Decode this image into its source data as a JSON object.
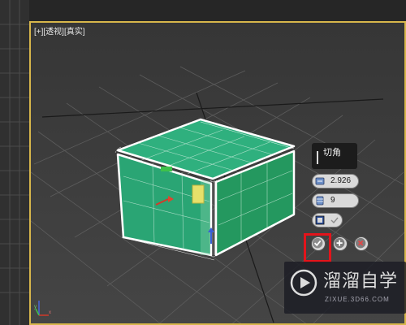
{
  "viewport": {
    "label": "[+][透视][真实]",
    "border_color": "#d7b64b",
    "box_color": "#2fb07e"
  },
  "chamfer_caddy": {
    "title": "切角",
    "amount_value": "2.926",
    "segments_value": "9",
    "ok_icon": "checkmark-icon",
    "apply_icon": "plus-icon",
    "cancel_icon": "x-icon",
    "highlight_color": "#e3141b"
  },
  "watermark": {
    "brand": "溜溜自学",
    "url": "ZIXUE.3D66.COM"
  }
}
